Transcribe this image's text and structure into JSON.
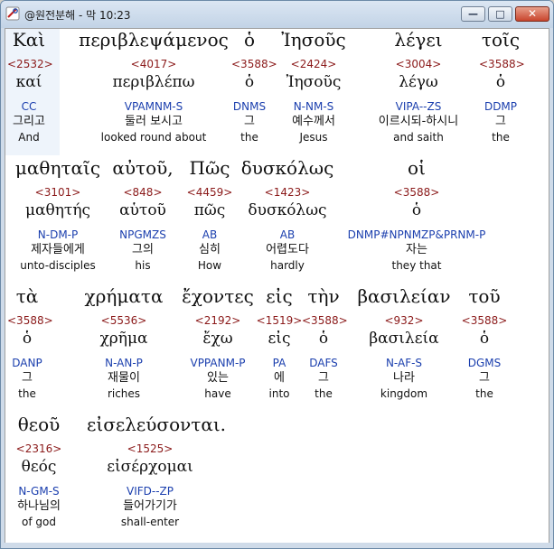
{
  "window": {
    "title": "@원전분해 - 막 10:23",
    "min_label": "—",
    "max_label": "□",
    "close_label": "✕"
  },
  "rows": [
    {
      "words": [
        {
          "greek": "Καὶ",
          "strong": "<2532>",
          "lemma": "καί",
          "morph": "CC",
          "korean": "그리고",
          "english": "And"
        },
        {
          "greek": "περιβλεψάμενος",
          "strong": "<4017>",
          "lemma": "περιβλέπω",
          "morph": "VPAMNM-S",
          "korean": "둘러 보시고",
          "english": "looked round about"
        },
        {
          "greek": "ὁ",
          "strong": "<3588>",
          "lemma": "ὁ",
          "morph": "DNMS",
          "korean": "그",
          "english": "the"
        },
        {
          "greek": "Ἰησοῦς",
          "strong": "<2424>",
          "lemma": "Ἰησοῦς",
          "morph": "N-NM-S",
          "korean": "예수께서",
          "english": "Jesus"
        },
        {
          "greek": "λέγει",
          "strong": "<3004>",
          "lemma": "λέγω",
          "morph": "VIPA--ZS",
          "korean": "이르시되-하시니",
          "english": "and saith"
        },
        {
          "greek": "τοῖς",
          "strong": "<3588>",
          "lemma": "ὁ",
          "morph": "DDMP",
          "korean": "그",
          "english": "the"
        }
      ]
    },
    {
      "words": [
        {
          "greek": "μαθηταῖς",
          "strong": "<3101>",
          "lemma": "μαθητής",
          "morph": "N-DM-P",
          "korean": "제자들에게",
          "english": "unto-disciples"
        },
        {
          "greek": "αὐτοῦ,",
          "strong": "<848>",
          "lemma": "αὑτοῦ",
          "morph": "NPGMZS",
          "korean": "그의",
          "english": "his"
        },
        {
          "greek": "Πῶς",
          "strong": "<4459>",
          "lemma": "πῶς",
          "morph": "AB",
          "korean": "심히",
          "english": "How"
        },
        {
          "greek": "δυσκόλως",
          "strong": "<1423>",
          "lemma": "δυσκόλως",
          "morph": "AB",
          "korean": "어렵도다",
          "english": "hardly"
        },
        {
          "greek": "οἱ",
          "strong": "<3588>",
          "lemma": "ὁ",
          "morph": "DNMP#NPNMZP&PRNM-P",
          "korean": "자는",
          "english": "they that"
        }
      ]
    },
    {
      "words": [
        {
          "greek": "τὰ",
          "strong": "<3588>",
          "lemma": "ὁ",
          "morph": "DANP",
          "korean": "그",
          "english": "the"
        },
        {
          "greek": "χρήματα",
          "strong": "<5536>",
          "lemma": "χρῆμα",
          "morph": "N-AN-P",
          "korean": "재물이",
          "english": "riches"
        },
        {
          "greek": "ἔχοντες",
          "strong": "<2192>",
          "lemma": "ἔχω",
          "morph": "VPPANM-P",
          "korean": "있는",
          "english": "have"
        },
        {
          "greek": "εἰς",
          "strong": "<1519>",
          "lemma": "εἰς",
          "morph": "PA",
          "korean": "에",
          "english": "into"
        },
        {
          "greek": "τὴν",
          "strong": "<3588>",
          "lemma": "ὁ",
          "morph": "DAFS",
          "korean": "그",
          "english": "the"
        },
        {
          "greek": "βασιλείαν",
          "strong": "<932>",
          "lemma": "βασιλεία",
          "morph": "N-AF-S",
          "korean": "나라",
          "english": "kingdom"
        },
        {
          "greek": "τοῦ",
          "strong": "<3588>",
          "lemma": "ὁ",
          "morph": "DGMS",
          "korean": "그",
          "english": "the"
        }
      ]
    },
    {
      "words": [
        {
          "greek": "θεοῦ",
          "strong": "<2316>",
          "lemma": "θεός",
          "morph": "N-GM-S",
          "korean": "하나님의",
          "english": "of god"
        },
        {
          "greek": "εἰσελεύσονται.",
          "strong": "<1525>",
          "lemma": "εἰσέρχομαι",
          "morph": "VIFD--ZP",
          "korean": "들어가기가",
          "english": "shall-enter"
        }
      ]
    }
  ]
}
